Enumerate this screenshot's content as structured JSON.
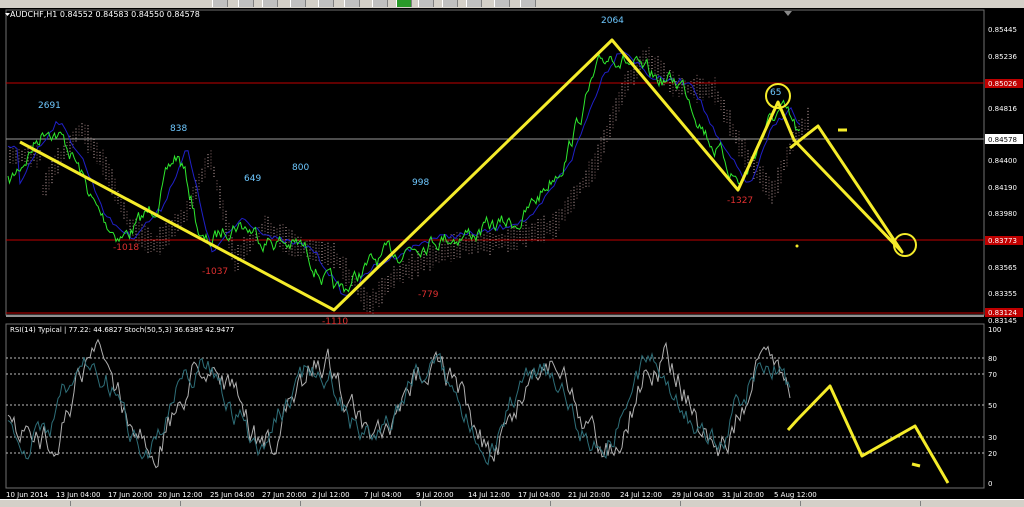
{
  "window": {
    "main_header": "AUDCHF,H1  0.84552 0.84583 0.84550 0.84578",
    "sub_header": "RSI(14) Typical | 77.22: 44.6827  Stoch(50,5,3) 36.6385 42.9477"
  },
  "colors": {
    "background": "#000000",
    "price_line": "#2ee82e",
    "annotation": "#f5ec2a",
    "cloud_a": "#d8b8b8",
    "cloud_b": "#8a6a6a",
    "level_line": "#c00000",
    "swing_label_top": "#6ec8ff",
    "swing_label_bottom": "#e03030",
    "rsi_line": "#2e6e78",
    "stoch_line": "#b0b0b0",
    "axis_text": "#ffffff"
  },
  "main_chart": {
    "price_axis_labels": [
      "0.85445",
      "0.85236",
      "0.84816",
      "0.84400",
      "0.84190",
      "0.83980",
      "0.83565",
      "0.83355",
      "0.83145"
    ],
    "level_markers": [
      {
        "label": "0.85026"
      },
      {
        "label": "0.84578"
      },
      {
        "label": "0.83773"
      },
      {
        "label": "0.83124"
      }
    ],
    "swing_labels_top": [
      "2691",
      "838",
      "649",
      "800",
      "998",
      "2064",
      "65"
    ],
    "swing_labels_bottom": [
      "-1018",
      "-1037",
      "-1110",
      "-779",
      "-1327"
    ]
  },
  "sub_chart": {
    "axis_labels": [
      "100",
      "80",
      "70",
      "50",
      "30",
      "20",
      "0"
    ]
  },
  "time_axis": {
    "labels": [
      "10 Jun 2014",
      "13 Jun 04:00",
      "17 Jun 20:00",
      "20 Jun 12:00",
      "25 Jun 04:00",
      "27 Jun 20:00",
      "2 Jul 12:00",
      "7 Jul 04:00",
      "9 Jul 20:00",
      "14 Jul 12:00",
      "17 Jul 04:00",
      "21 Jul 20:00",
      "24 Jul 12:00",
      "29 Jul 04:00",
      "31 Jul 20:00",
      "5 Aug 12:00"
    ]
  }
}
